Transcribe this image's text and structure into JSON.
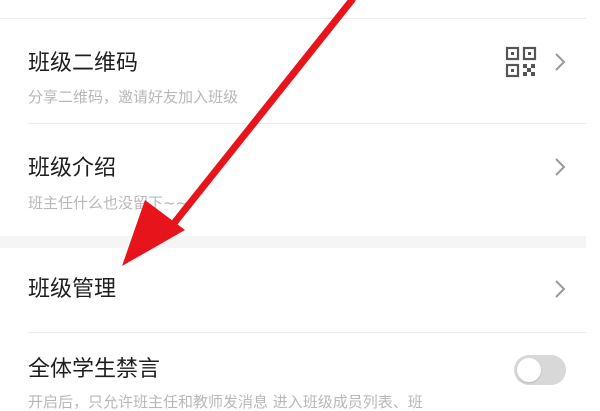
{
  "settings": {
    "class_qr": {
      "title": "班级二维码",
      "subtitle": "分享二维码，邀请好友加入班级",
      "icon": "qr-code-icon"
    },
    "class_intro": {
      "title": "班级介绍",
      "subtitle": "班主任什么也没留下~~"
    },
    "class_manage": {
      "title": "班级管理"
    },
    "mute_all": {
      "title": "全体学生禁言",
      "subtitle": "开启后，只允许班主任和教师发消息 进入班级成员列表、班",
      "enabled": false
    }
  },
  "colors": {
    "annotation_arrow": "#e8141b",
    "title_text": "#1e1e1e",
    "subtitle_text": "#b8b8b8",
    "toggle_off": "#d8d8d8"
  },
  "annotation": {
    "type": "arrow",
    "points_to": "class-manage-row"
  }
}
